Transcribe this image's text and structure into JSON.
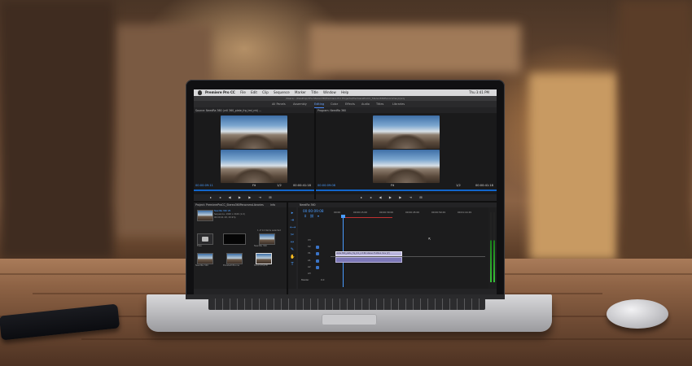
{
  "menubar": {
    "app_name": "Premiere Pro CC",
    "items": [
      "File",
      "Edit",
      "Clip",
      "Sequence",
      "Marker",
      "Title",
      "Window",
      "Help"
    ],
    "right_text": "Thu 3:41 PM"
  },
  "path_text": "/Users/.../Desktop/Vhs-Stereo3D/Premiere Pro Projects/PremiereProCC_Stereo360Panorama.prproj",
  "workspaces": [
    "All Panels",
    "Assembly",
    "Editing",
    "Color",
    "Effects",
    "Audio",
    "Titles",
    "Libraries"
  ],
  "active_workspace": "Editing",
  "source": {
    "title": "Source: NeedRa 360 (vr0 360_plate_frp_tml_rnt) ...",
    "timecode_in": "00:00:09:11",
    "fit": "Fit",
    "fraction": "1/2",
    "timecode_dur": "00:00:41:18"
  },
  "program": {
    "title": "Program: NeedRa 360",
    "timecode_in": "00:00:09:08",
    "fit": "Fit",
    "fraction": "1/2",
    "timecode_dur": "00:00:41:18"
  },
  "project": {
    "title": "Project: PremiereProCC_Stereo360Panorama",
    "tab2": "Libraries",
    "tab3": "Info",
    "clip_name": "NeedRa 360 VR",
    "clip_info": "Sequence, 1920 x 2160 (1.0)",
    "clip_info2": "00:00:41:18, 29.97p",
    "items_label": "1 of 12 items selected",
    "bins": [
      "Files",
      "",
      "",
      "",
      "",
      "",
      "",
      "",
      ""
    ],
    "thumb_labels": [
      "",
      "",
      "NeedRa 360",
      "NeedRa 360",
      "ElizabethBoone",
      "PanoramaVR",
      "NeedRa 360",
      "NeedRa 360",
      "NeedRa 360"
    ]
  },
  "timeline": {
    "tab": "NeedRa 360",
    "timecode": "00:00:09:08",
    "ruler": [
      "00:00",
      "00:00:15:00",
      "00:00:30:00",
      "00:00:45:00",
      "00:00:59:29",
      "00:01:14:29"
    ],
    "tracks": [
      "V3",
      "V2",
      "V1",
      "A1",
      "A2",
      "A3",
      "Master"
    ],
    "clip_top": "plate:360_plate_frp_tml_rnt:60 stereo-Foldbox.mov [V]",
    "clip_bottom": "plate:360_plate_frp_tml_rnt:60 stereo-Foldbox.mov [A]",
    "master_value": "0.0"
  },
  "colors": {
    "accent": "#4a9cff",
    "clip": "#b9b4dc",
    "panel_bg": "#232325"
  },
  "icons": [
    "apple-icon",
    "play-icon",
    "step-back-icon",
    "step-forward-icon",
    "selection-tool-icon",
    "razor-tool-icon",
    "hand-tool-icon",
    "text-tool-icon"
  ]
}
